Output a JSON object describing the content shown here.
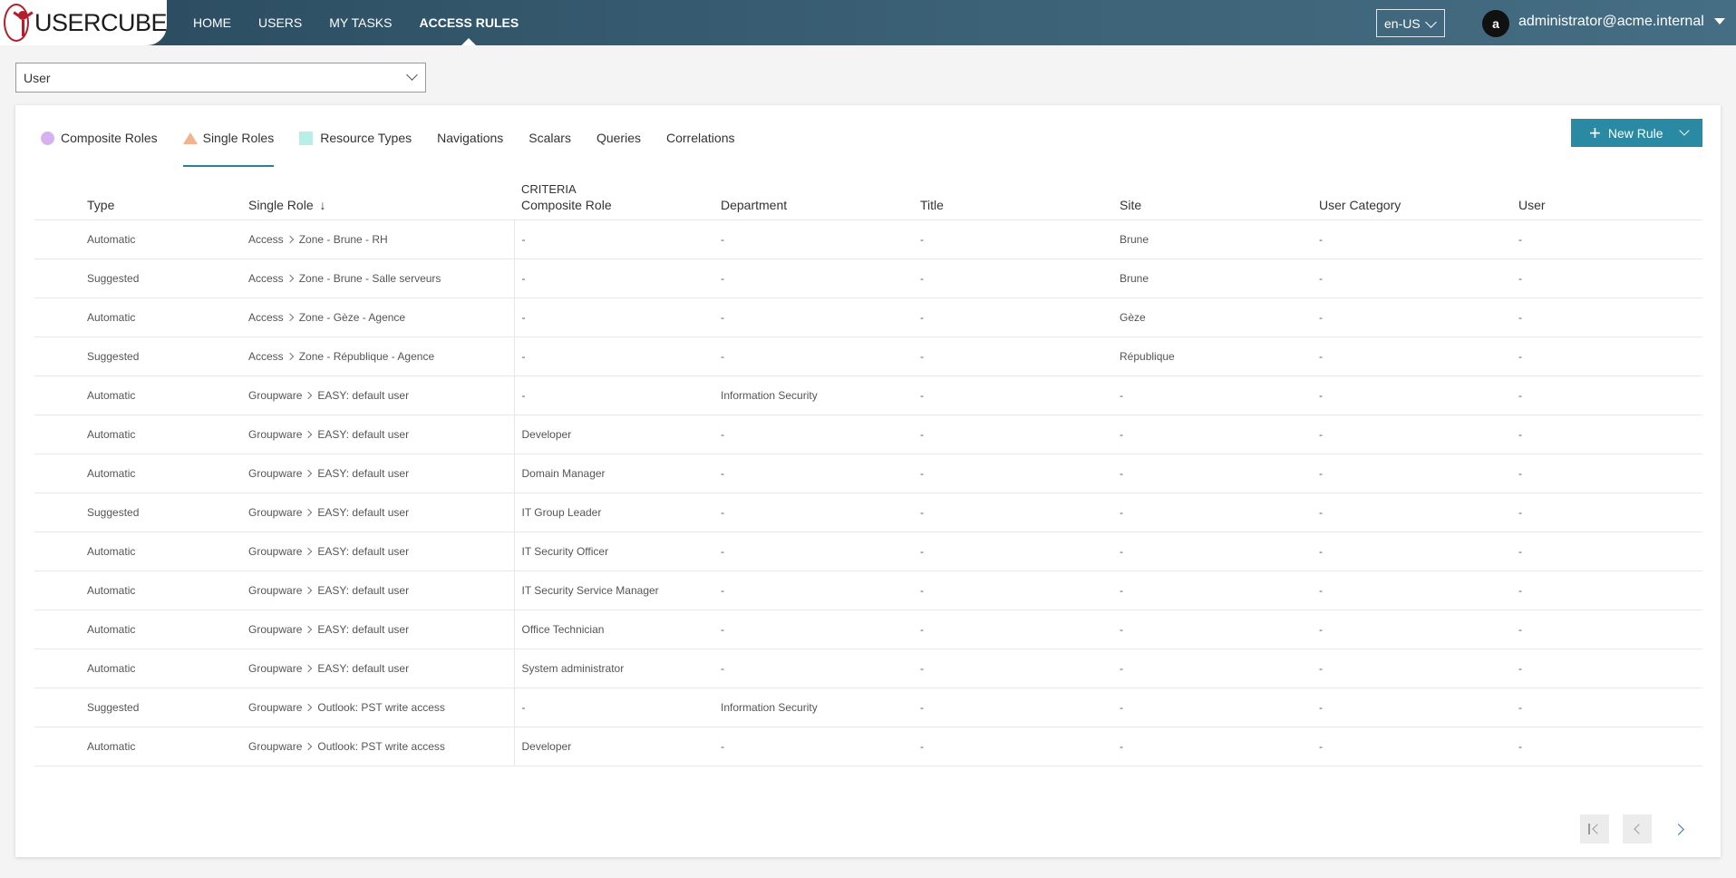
{
  "app": {
    "logo_text": "USERCUBE"
  },
  "nav": [
    {
      "label": "HOME",
      "active": false
    },
    {
      "label": "USERS",
      "active": false
    },
    {
      "label": "MY TASKS",
      "active": false
    },
    {
      "label": "ACCESS RULES",
      "active": true
    }
  ],
  "header": {
    "language": "en-US",
    "avatar_initial": "a",
    "user_email": "administrator@acme.internal"
  },
  "entity_select": {
    "value": "User"
  },
  "tabs": [
    {
      "label": "Composite Roles",
      "icon": "circle-icon",
      "color": "#d8b2f0",
      "active": false
    },
    {
      "label": "Single Roles",
      "icon": "triangle-icon",
      "color": "#f0b48e",
      "active": true
    },
    {
      "label": "Resource Types",
      "icon": "square-icon",
      "color": "#b8eee8",
      "active": false
    },
    {
      "label": "Navigations",
      "active": false
    },
    {
      "label": "Scalars",
      "active": false
    },
    {
      "label": "Queries",
      "active": false
    },
    {
      "label": "Correlations",
      "active": false
    }
  ],
  "new_rule_label": "New Rule",
  "table": {
    "criteria_label": "CRITERIA",
    "sort_indicator": "↓",
    "columns": [
      "Type",
      "Single Role",
      "Composite Role",
      "Department",
      "Title",
      "Site",
      "User Category",
      "User"
    ],
    "rows": [
      {
        "type": "Automatic",
        "role_parent": "Access",
        "role": "Zone - Brune - RH",
        "composite": "-",
        "department": "-",
        "title": "-",
        "site": "Brune",
        "category": "-",
        "user": "-"
      },
      {
        "type": "Suggested",
        "role_parent": "Access",
        "role": "Zone - Brune - Salle serveurs",
        "composite": "-",
        "department": "-",
        "title": "-",
        "site": "Brune",
        "category": "-",
        "user": "-"
      },
      {
        "type": "Automatic",
        "role_parent": "Access",
        "role": "Zone - Gèze - Agence",
        "composite": "-",
        "department": "-",
        "title": "-",
        "site": "Gèze",
        "category": "-",
        "user": "-"
      },
      {
        "type": "Suggested",
        "role_parent": "Access",
        "role": "Zone - République - Agence",
        "composite": "-",
        "department": "-",
        "title": "-",
        "site": "République",
        "category": "-",
        "user": "-"
      },
      {
        "type": "Automatic",
        "role_parent": "Groupware",
        "role": "EASY: default user",
        "composite": "-",
        "department": "Information Security",
        "title": "-",
        "site": "-",
        "category": "-",
        "user": "-"
      },
      {
        "type": "Automatic",
        "role_parent": "Groupware",
        "role": "EASY: default user",
        "composite": "Developer",
        "department": "-",
        "title": "-",
        "site": "-",
        "category": "-",
        "user": "-"
      },
      {
        "type": "Automatic",
        "role_parent": "Groupware",
        "role": "EASY: default user",
        "composite": "Domain Manager",
        "department": "-",
        "title": "-",
        "site": "-",
        "category": "-",
        "user": "-"
      },
      {
        "type": "Suggested",
        "role_parent": "Groupware",
        "role": "EASY: default user",
        "composite": "IT Group Leader",
        "department": "-",
        "title": "-",
        "site": "-",
        "category": "-",
        "user": "-"
      },
      {
        "type": "Automatic",
        "role_parent": "Groupware",
        "role": "EASY: default user",
        "composite": "IT Security Officer",
        "department": "-",
        "title": "-",
        "site": "-",
        "category": "-",
        "user": "-"
      },
      {
        "type": "Automatic",
        "role_parent": "Groupware",
        "role": "EASY: default user",
        "composite": "IT Security Service Manager",
        "department": "-",
        "title": "-",
        "site": "-",
        "category": "-",
        "user": "-"
      },
      {
        "type": "Automatic",
        "role_parent": "Groupware",
        "role": "EASY: default user",
        "composite": "Office Technician",
        "department": "-",
        "title": "-",
        "site": "-",
        "category": "-",
        "user": "-"
      },
      {
        "type": "Automatic",
        "role_parent": "Groupware",
        "role": "EASY: default user",
        "composite": "System administrator",
        "department": "-",
        "title": "-",
        "site": "-",
        "category": "-",
        "user": "-"
      },
      {
        "type": "Suggested",
        "role_parent": "Groupware",
        "role": "Outlook: PST write access",
        "composite": "-",
        "department": "Information Security",
        "title": "-",
        "site": "-",
        "category": "-",
        "user": "-"
      },
      {
        "type": "Automatic",
        "role_parent": "Groupware",
        "role": "Outlook: PST write access",
        "composite": "Developer",
        "department": "-",
        "title": "-",
        "site": "-",
        "category": "-",
        "user": "-"
      }
    ]
  },
  "pagination": {
    "first_disabled": true,
    "prev_disabled": true,
    "next_disabled": false
  }
}
